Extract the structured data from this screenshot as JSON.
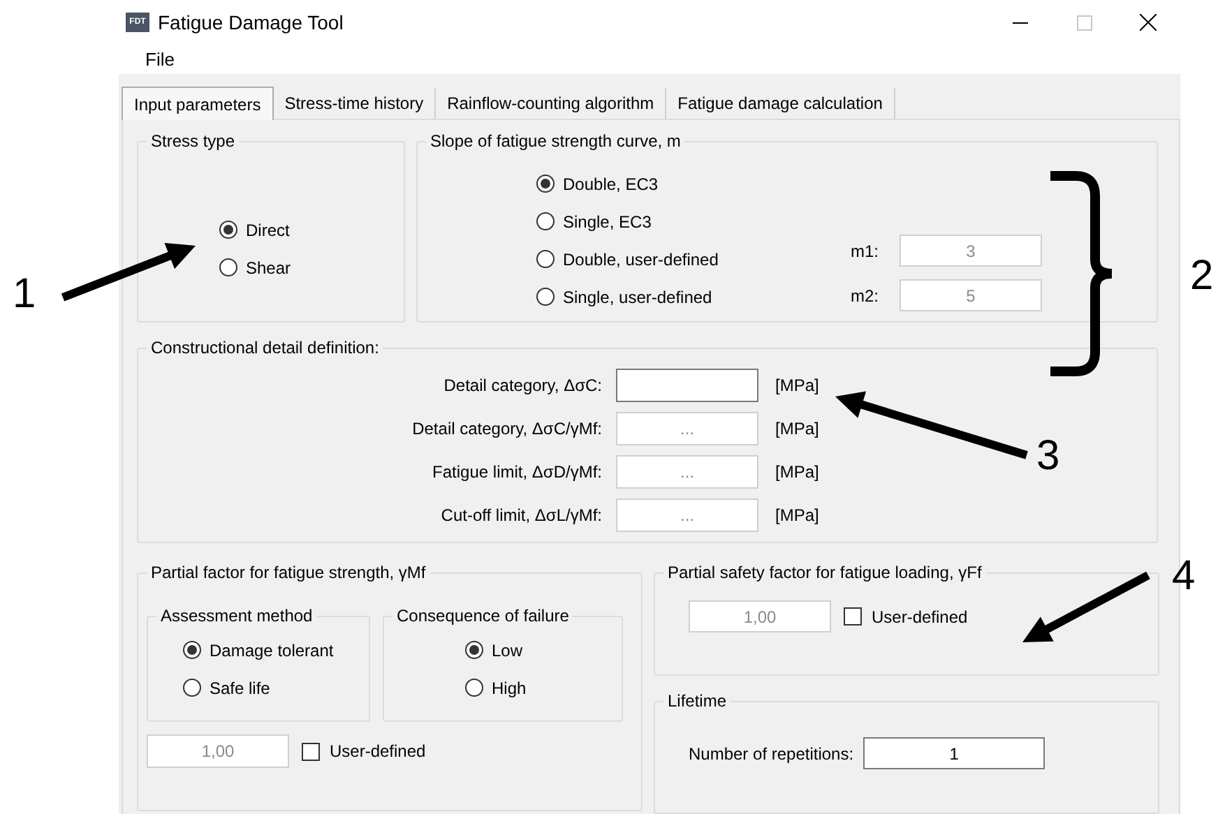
{
  "window": {
    "title": "Fatigue Damage Tool",
    "icon_text": "FDT"
  },
  "menu": [
    "File"
  ],
  "tabs": [
    {
      "label": "Input parameters",
      "selected": true
    },
    {
      "label": "Stress-time history",
      "selected": false
    },
    {
      "label": "Rainflow-counting algorithm",
      "selected": false
    },
    {
      "label": "Fatigue damage calculation",
      "selected": false
    }
  ],
  "stress_type": {
    "title": "Stress type",
    "options": [
      {
        "label": "Direct",
        "selected": true
      },
      {
        "label": "Shear",
        "selected": false
      }
    ]
  },
  "slope": {
    "title": "Slope of fatigue strength curve, m",
    "options": [
      {
        "label": "Double, EC3",
        "selected": true
      },
      {
        "label": "Single, EC3",
        "selected": false
      },
      {
        "label": "Double, user-defined",
        "selected": false
      },
      {
        "label": "Single, user-defined",
        "selected": false
      }
    ],
    "fields": [
      {
        "label": "m1:",
        "value": "3",
        "disabled": true
      },
      {
        "label": "m2:",
        "value": "5",
        "disabled": true
      }
    ]
  },
  "detail": {
    "title": "Constructional detail definition:",
    "rows": [
      {
        "label": "Detail category, ΔσC:",
        "unit": "[MPa]",
        "disabled": false
      },
      {
        "label": "Detail category, ΔσC/γMf:",
        "value": "...",
        "unit": "[MPa]",
        "disabled": true
      },
      {
        "label": "Fatigue limit, ΔσD/γMf:",
        "value": "...",
        "unit": "[MPa]",
        "disabled": true
      },
      {
        "label": "Cut-off limit, ΔσL/γMf:",
        "value": "...",
        "unit": "[MPa]",
        "disabled": true
      }
    ]
  },
  "partial_strength": {
    "title": "Partial factor for fatigue strength, γMf",
    "assessment": {
      "title": "Assessment method",
      "options": [
        {
          "label": "Damage tolerant",
          "selected": true
        },
        {
          "label": "Safe life",
          "selected": false
        }
      ]
    },
    "consequence": {
      "title": "Consequence of failure",
      "options": [
        {
          "label": "Low",
          "selected": true
        },
        {
          "label": "High",
          "selected": false
        }
      ]
    },
    "value": "1,00",
    "disabled": true,
    "user_defined": {
      "label": "User-defined",
      "checked": false
    }
  },
  "partial_loading": {
    "title": "Partial safety factor for fatigue loading, γFf",
    "value": "1,00",
    "disabled": true,
    "user_defined": {
      "label": "User-defined",
      "checked": false
    }
  },
  "lifetime": {
    "title": "Lifetime",
    "label": "Number of repetitions:",
    "value": "1",
    "disabled": false
  },
  "annotations": [
    {
      "label": "1",
      "kind": "arrow"
    },
    {
      "label": "2",
      "kind": "brace"
    },
    {
      "label": "3",
      "kind": "arrow"
    },
    {
      "label": "4",
      "kind": "arrow"
    }
  ]
}
